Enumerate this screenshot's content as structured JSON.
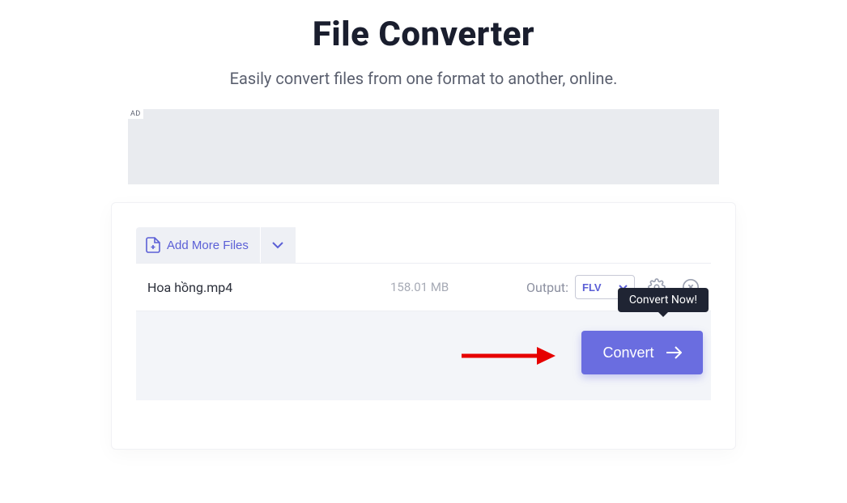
{
  "header": {
    "title": "File Converter",
    "subtitle": "Easily convert files from one format to another, online."
  },
  "ad": {
    "label": "AD"
  },
  "toolbar": {
    "add_more_label": "Add More Files"
  },
  "file": {
    "name": "Hoa hồng.mp4",
    "size": "158.01 MB",
    "output_label": "Output:",
    "format": "FLV"
  },
  "tooltip": {
    "text": "Convert Now!"
  },
  "actions": {
    "convert_label": "Convert"
  }
}
